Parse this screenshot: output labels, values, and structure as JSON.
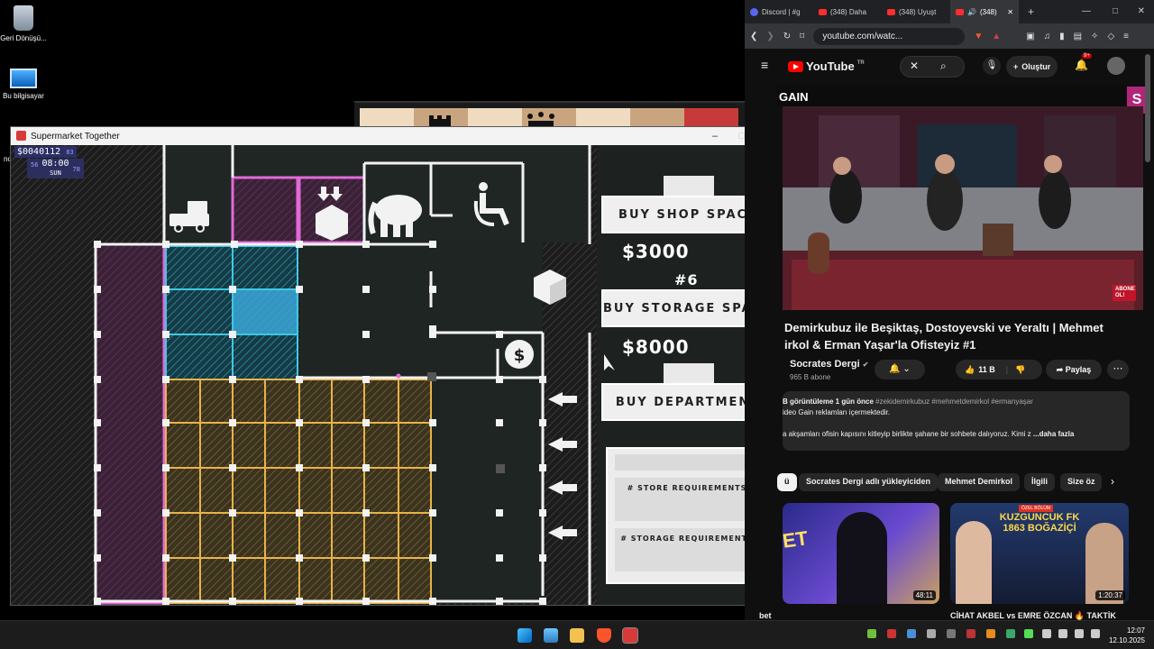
{
  "desktop": {
    "icons": [
      {
        "label": "Geri Dönüşü...",
        "icon": "recycle-bin-icon"
      },
      {
        "label": "Bu bilgisayar",
        "icon": "computer-icon"
      }
    ],
    "partial_label": "no"
  },
  "game_window": {
    "title": "Supermarket Together",
    "money": "$0040112",
    "money_suffix": "83",
    "clock_left": "56",
    "clock_time": "08:00",
    "clock_day": "SUN",
    "clock_right": "78",
    "buy_shop_space": "BUY SHOP SPACE",
    "shop_price": "$3000",
    "storage_number": "#6",
    "buy_storage_space": "BUY STORAGE SPACE",
    "storage_price": "$8000",
    "buy_department": "BUY DEPARTMENT",
    "store_requirements": "# STORE REQUIREMENTS",
    "storage_requirements": "# STORAGE REQUIREMENTS",
    "map_colors": {
      "pink": "#e06ad8",
      "cyan": "#3fc8e6",
      "gold": "#e8b447",
      "white": "#f2f2f2"
    }
  },
  "browser": {
    "tabs": [
      {
        "label": "Discord | #g",
        "icon": "discord-icon"
      },
      {
        "label": "(348) Daha",
        "icon": "youtube-icon"
      },
      {
        "label": "(348) Uyuşt",
        "icon": "youtube-icon"
      },
      {
        "label": "(348)",
        "icon": "youtube-icon",
        "active": true
      }
    ],
    "url": "youtube.com/watc...",
    "youtube": {
      "logo": "YouTube",
      "logo_region": "TR",
      "create_label": "Oluştur",
      "notifications": "9+",
      "channel_brand_left": "GAIN",
      "channel_brand_right": "S",
      "video_badge": "ABONE OL!",
      "title": "Demirkubuz ile Beşiktaş, Dostoyevski ve Yeraltı | Mehmet irkol & Erman Yaşar'la Ofisteyiz #1",
      "channel": "Socrates Dergi",
      "subscribers": "965 B abone",
      "likes": "11 B",
      "share": "Paylaş",
      "views": "B görüntüleme  1 gün önce",
      "hashtags": "#zekidemirkubuz #mehmetdemirkol #ermanyaşar",
      "desc_line1": "ideo Gain reklamları içermektedir.",
      "desc_line2": "a akşamları ofisin kapısını kitleyip birlikte şahane bir sohbete dalıyoruz. Kimi z",
      "desc_more": "...daha fazla",
      "chips": [
        "ü",
        "Socrates Dergi adlı yükleyiciden",
        "Mehmet Demirkol",
        "İlgili",
        "Size öz"
      ],
      "thumbnails": [
        {
          "duration": "48:11",
          "overlay": "ET",
          "caption": "bet"
        },
        {
          "duration": "1:20:37",
          "overlay": "KUZGUNCUK FK 1863 BOĞAZİÇİ",
          "tag": "ÖZEL BÖLÜM",
          "caption": "CİHAT AKBEL vs EMRE ÖZCAN 🔥 TAKTİK"
        }
      ]
    }
  },
  "taskbar": {
    "time": "12:07",
    "date": "12.10.2025"
  }
}
